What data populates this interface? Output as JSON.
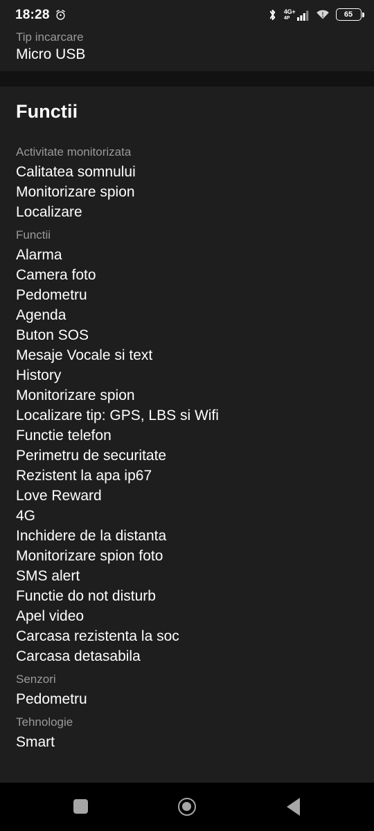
{
  "statusbar": {
    "time": "18:28",
    "alarm_icon": "alarm-clock-icon",
    "bluetooth_icon": "bluetooth-icon",
    "network_label": "4G+",
    "network_sub_label": "4P",
    "signal_icon": "cellular-signal-icon",
    "wifi_icon": "wifi-warning-icon",
    "battery_level": "65",
    "battery_icon": "battery-icon"
  },
  "top_card": {
    "label": "Tip incarcare",
    "value": "Micro USB"
  },
  "main_card": {
    "heading": "Functii",
    "groups": [
      {
        "label": "Activitate monitorizata",
        "items": [
          "Calitatea somnului",
          "Monitorizare spion",
          "Localizare"
        ]
      },
      {
        "label": "Functii",
        "items": [
          "Alarma",
          "Camera foto",
          "Pedometru",
          "Agenda",
          "Buton SOS",
          "Mesaje Vocale si text",
          "History",
          "Monitorizare spion",
          "Localizare tip: GPS, LBS si Wifi",
          "Functie telefon",
          "Perimetru de securitate",
          "Rezistent la apa ip67",
          "Love Reward",
          "4G",
          "Inchidere de la distanta",
          "Monitorizare spion foto",
          "SMS alert",
          "Functie do not disturb",
          "Apel video",
          "Carcasa rezistenta la soc",
          "Carcasa detasabila"
        ]
      },
      {
        "label": "Senzori",
        "items": [
          "Pedometru"
        ]
      },
      {
        "label": "Tehnologie",
        "items": [
          "Smart"
        ]
      }
    ]
  },
  "navbar": {
    "recents_icon": "square-recents-icon",
    "home_icon": "circle-home-icon",
    "back_icon": "triangle-back-icon"
  },
  "colors": {
    "background": "#1e1e1e",
    "divider": "#121212",
    "navbar": "#000000",
    "text_primary": "#ffffff",
    "text_secondary": "#9a9a9a",
    "nav_icon": "#a6a6a6"
  }
}
